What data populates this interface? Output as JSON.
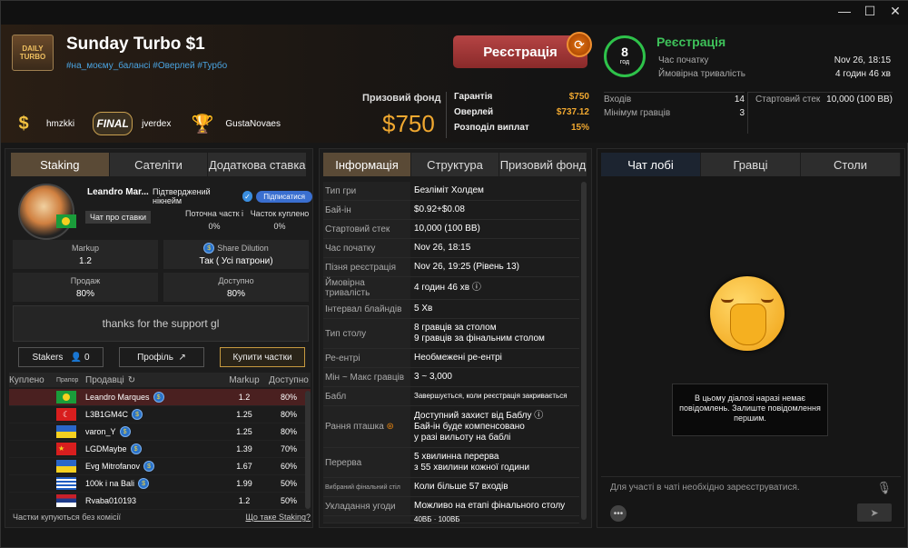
{
  "window": {
    "minimize": "—",
    "maximize": "☐",
    "close": "✕"
  },
  "header": {
    "logo_text": "DAILY TURBO",
    "title": "Sunday Turbo $1",
    "tags": "#на_моєму_балансі #Оверлей #Турбо",
    "badges": [
      {
        "icon": "$",
        "name": "hmzkki"
      },
      {
        "icon": "FINAL",
        "name": "jverdex"
      },
      {
        "icon": "🏆",
        "name": "GustaNovaes"
      }
    ],
    "register_button": "Реєстрація",
    "prize_label": "Призовий фонд",
    "prize_value": "$750",
    "guarantee": [
      {
        "k": "Гарантія",
        "v": "$750"
      },
      {
        "k": "Оверлей",
        "v": "$737.12"
      },
      {
        "k": "Розподіл виплат",
        "v": "15%"
      }
    ],
    "clock": {
      "value": "8",
      "unit": "год"
    },
    "status": "Реєстрація",
    "start_time_label": "Час початку",
    "start_time": "Nov 26, 18:15",
    "duration_label": "Ймовірна тривалість",
    "duration": "4 годин 46 хв",
    "entries_label": "Входів",
    "entries": "14",
    "min_players_label": "Мінімум гравців",
    "min_players": "3",
    "stack_label": "Стартовий стек",
    "stack": "10,000 (100 BB)"
  },
  "left": {
    "tabs": [
      "Staking",
      "Сателіти",
      "Додаткова ставка"
    ],
    "staker_name": "Leandro Mar...",
    "verified_label": "Підтверджений нікнейм",
    "subscribe": "Підписатися",
    "chat_btn": "Чат про ставки",
    "cur_share_label": "Поточна частк і",
    "cur_share": "0%",
    "bought_label": "Часток куплено",
    "bought": "0%",
    "markup_label": "Markup",
    "markup": "1.2",
    "dilution_label": "Share Dilution",
    "dilution": "Так ( Усі патрони)",
    "sale_label": "Продаж",
    "sale": "80%",
    "available_label": "Доступно",
    "available": "80%",
    "message": "thanks for the support gl",
    "stakers_btn": "Stakers",
    "stakers_count": "0",
    "profile_btn": "Профіль",
    "buy_btn": "Купити частки",
    "table_headers": [
      "Куплено",
      "Прапор",
      "Продавці",
      "Markup",
      "Доступно"
    ],
    "rows": [
      {
        "flag": "br",
        "name": "Leandro Marques",
        "markup": "1.2",
        "avail": "80%"
      },
      {
        "flag": "tr",
        "name": "L3B1GM4C",
        "markup": "1.25",
        "avail": "80%"
      },
      {
        "flag": "ua",
        "name": "varon_Y",
        "markup": "1.25",
        "avail": "80%"
      },
      {
        "flag": "cn",
        "name": "LGDMaybe",
        "markup": "1.39",
        "avail": "70%"
      },
      {
        "flag": "ua",
        "name": "Evg Mitrofanov",
        "markup": "1.67",
        "avail": "60%"
      },
      {
        "flag": "gr",
        "name": "100k i na Bali",
        "markup": "1.99",
        "avail": "50%"
      },
      {
        "flag": "rs",
        "name": "Rvaba010193",
        "markup": "1.2",
        "avail": "50%"
      }
    ],
    "footer_left": "Частки купуються без комісії",
    "footer_link": "Що таке Staking?"
  },
  "mid": {
    "tabs": [
      "Інформація",
      "Структура",
      "Призовий фонд"
    ],
    "rows": [
      {
        "k": "Тип гри",
        "v": "Безліміт Холдем"
      },
      {
        "k": "Бай-ін",
        "v": "$0.92+$0.08"
      },
      {
        "k": "Стартовий стек",
        "v": "10,000 (100 BB)"
      },
      {
        "k": "Час початку",
        "v": "Nov 26, 18:15"
      },
      {
        "k": "Пізня реєстрація",
        "v": "Nov 26, 19:25 (Рівень 13)"
      },
      {
        "k": "Ймовірна тривалість",
        "v": "4 годин 46 хв ⓘ"
      },
      {
        "k": "Інтервал блайндів",
        "v": "5 Хв"
      },
      {
        "k": "Тип столу",
        "v": "8 гравців за столом\n9 гравців за фінальним столом"
      },
      {
        "k": "Ре-ентрі",
        "v": "Необмежені ре-ентрі"
      },
      {
        "k": "Мін ~ Макс гравців",
        "v": "3 ~ 3,000"
      },
      {
        "k": "Бабл",
        "v": "Завершується, коли реєстрація закривається"
      },
      {
        "k": "Рання пташка",
        "v": "Доступний захист від Баблу ⓘ\nБай-ін буде компенсовано\nу разі вильоту на баблі"
      },
      {
        "k": "Перерва",
        "v": "5 хвилинна перерва\nз 55 хвилини кожної години"
      },
      {
        "k": "Вибраний фінальний стіл",
        "v": "Коли більше 57 входів"
      },
      {
        "k": "Укладання угоди",
        "v": "Можливо на етапі фінального столу"
      }
    ],
    "partial": "40BБ · 100BБ"
  },
  "right": {
    "tabs": [
      "Чат лобі",
      "Гравці",
      "Столи"
    ],
    "empty": "В цьому діалозі наразі немає повідомлень. Залиште повідомлення першим.",
    "input_placeholder": "Для участі в чаті необхідно зареєструватися.",
    "more": "•••",
    "send": "➤"
  }
}
